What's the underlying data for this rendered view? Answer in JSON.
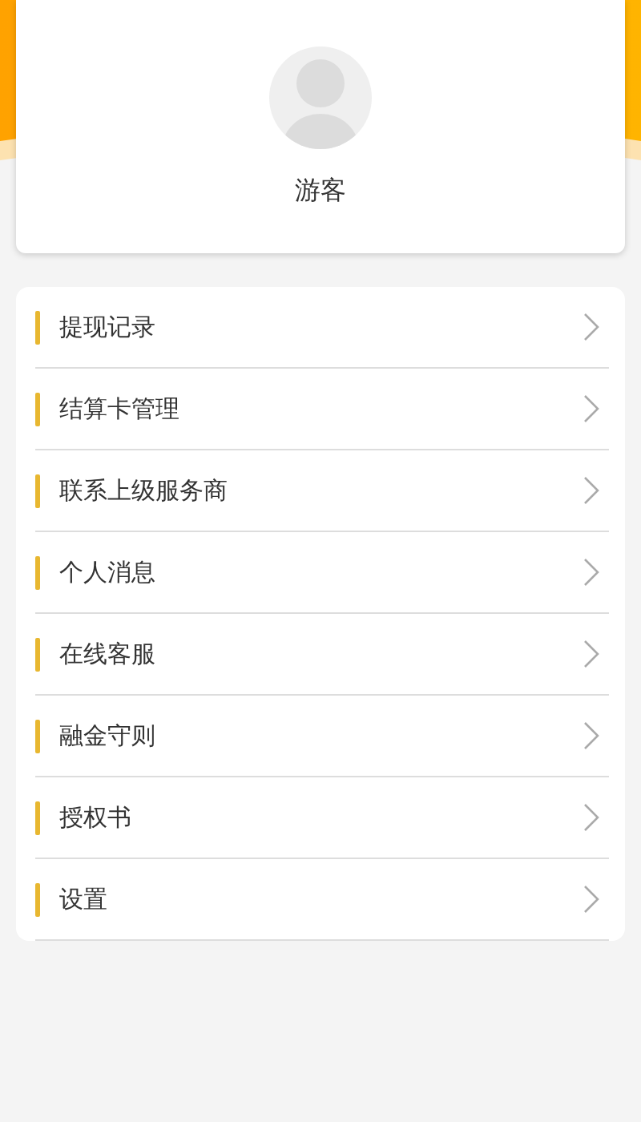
{
  "profile": {
    "name": "游客"
  },
  "menu": [
    {
      "label": "提现记录"
    },
    {
      "label": "结算卡管理"
    },
    {
      "label": "联系上级服务商"
    },
    {
      "label": "个人消息"
    },
    {
      "label": "在线客服"
    },
    {
      "label": "融金守则"
    },
    {
      "label": "授权书"
    },
    {
      "label": "设置"
    }
  ]
}
